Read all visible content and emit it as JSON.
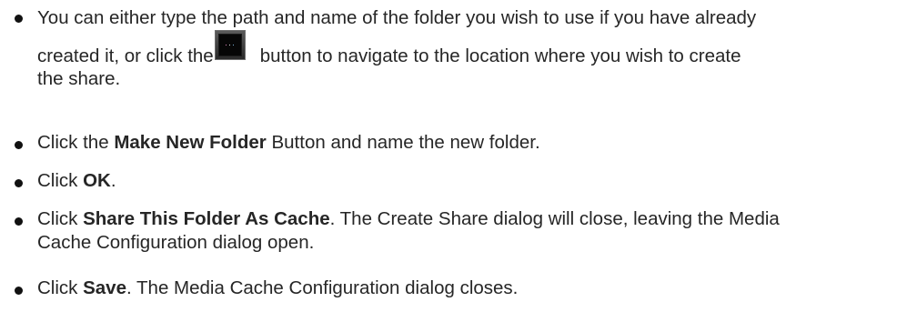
{
  "bullets": [
    {
      "line1": "You can either type the path and name of the folder you wish to use if you have already",
      "line2_before": "created it, or click the",
      "line2_after": "button to navigate to the location where you wish to create",
      "line3": "the share.",
      "browse_button_label": "..."
    },
    {
      "prefix": "Click the ",
      "bold": "Make New Folder",
      "suffix": " Button and name the new folder."
    },
    {
      "prefix": "Click ",
      "bold": "OK",
      "suffix": "."
    },
    {
      "prefix": "Click ",
      "bold": "Share This Folder As Cache",
      "suffix": ". The Create Share dialog will close, leaving the Media",
      "line2": "Cache Configuration dialog open."
    },
    {
      "prefix": "Click ",
      "bold": "Save",
      "suffix": ". The Media Cache Configuration dialog closes."
    }
  ]
}
